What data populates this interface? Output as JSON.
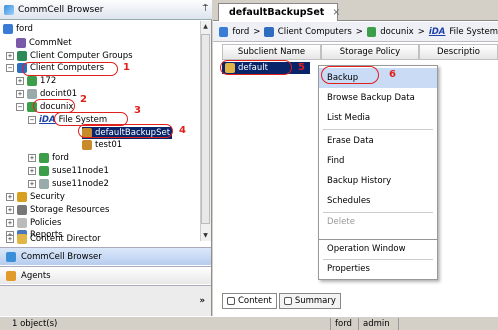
{
  "left_panel": {
    "title": "CommCell Browser",
    "pin_glyph": "⍑"
  },
  "tree": {
    "root": "ford",
    "commnet": "CommNet",
    "client_groups": "Client Computer Groups",
    "client_computers": "Client Computers",
    "node_172": "172",
    "docint01": "docint01",
    "docunix": "docunix",
    "file_system_prefix": "iDA",
    "file_system": "File System",
    "default_backupset": "defaultBackupSet",
    "test01": "test01",
    "ford_child": "ford",
    "suse11node1": "suse11node1",
    "suse11node2": "suse11node2",
    "security": "Security",
    "storage_resources": "Storage Resources",
    "policies": "Policies",
    "reports": "Reports",
    "content_director": "Content Director"
  },
  "annotations": {
    "n1": "1",
    "n2": "2",
    "n3": "3",
    "n4": "4",
    "n5": "5",
    "n6": "6"
  },
  "nav_bars": {
    "commcell_browser": "CommCell Browser",
    "agents": "Agents",
    "more": "»"
  },
  "right_panel": {
    "tab_title": "defaultBackupSet",
    "tab_close": "×",
    "breadcrumb": {
      "b1": "ford",
      "sep": ">",
      "b2": "Client Computers",
      "b3": "docunix",
      "b4_prefix": "iDA",
      "b4": "File System"
    },
    "columns": {
      "c1": "Subclient Name",
      "c2": "Storage Policy",
      "c3": "Descriptio"
    },
    "row_default": "default"
  },
  "context_menu": {
    "backup": "Backup",
    "browse": "Browse Backup Data",
    "list_media": "List Media",
    "erase": "Erase Data",
    "find": "Find",
    "history": "Backup History",
    "schedules": "Schedules",
    "delete": "Delete",
    "operation_window": "Operation Window",
    "properties": "Properties"
  },
  "bottom_tabs": {
    "content": "Content",
    "summary": "Summary"
  },
  "status": {
    "objects": "1 object(s)",
    "server": "ford",
    "user": "admin"
  },
  "colors": {
    "annotation": "#e0201c",
    "selection": "#0a246a"
  }
}
